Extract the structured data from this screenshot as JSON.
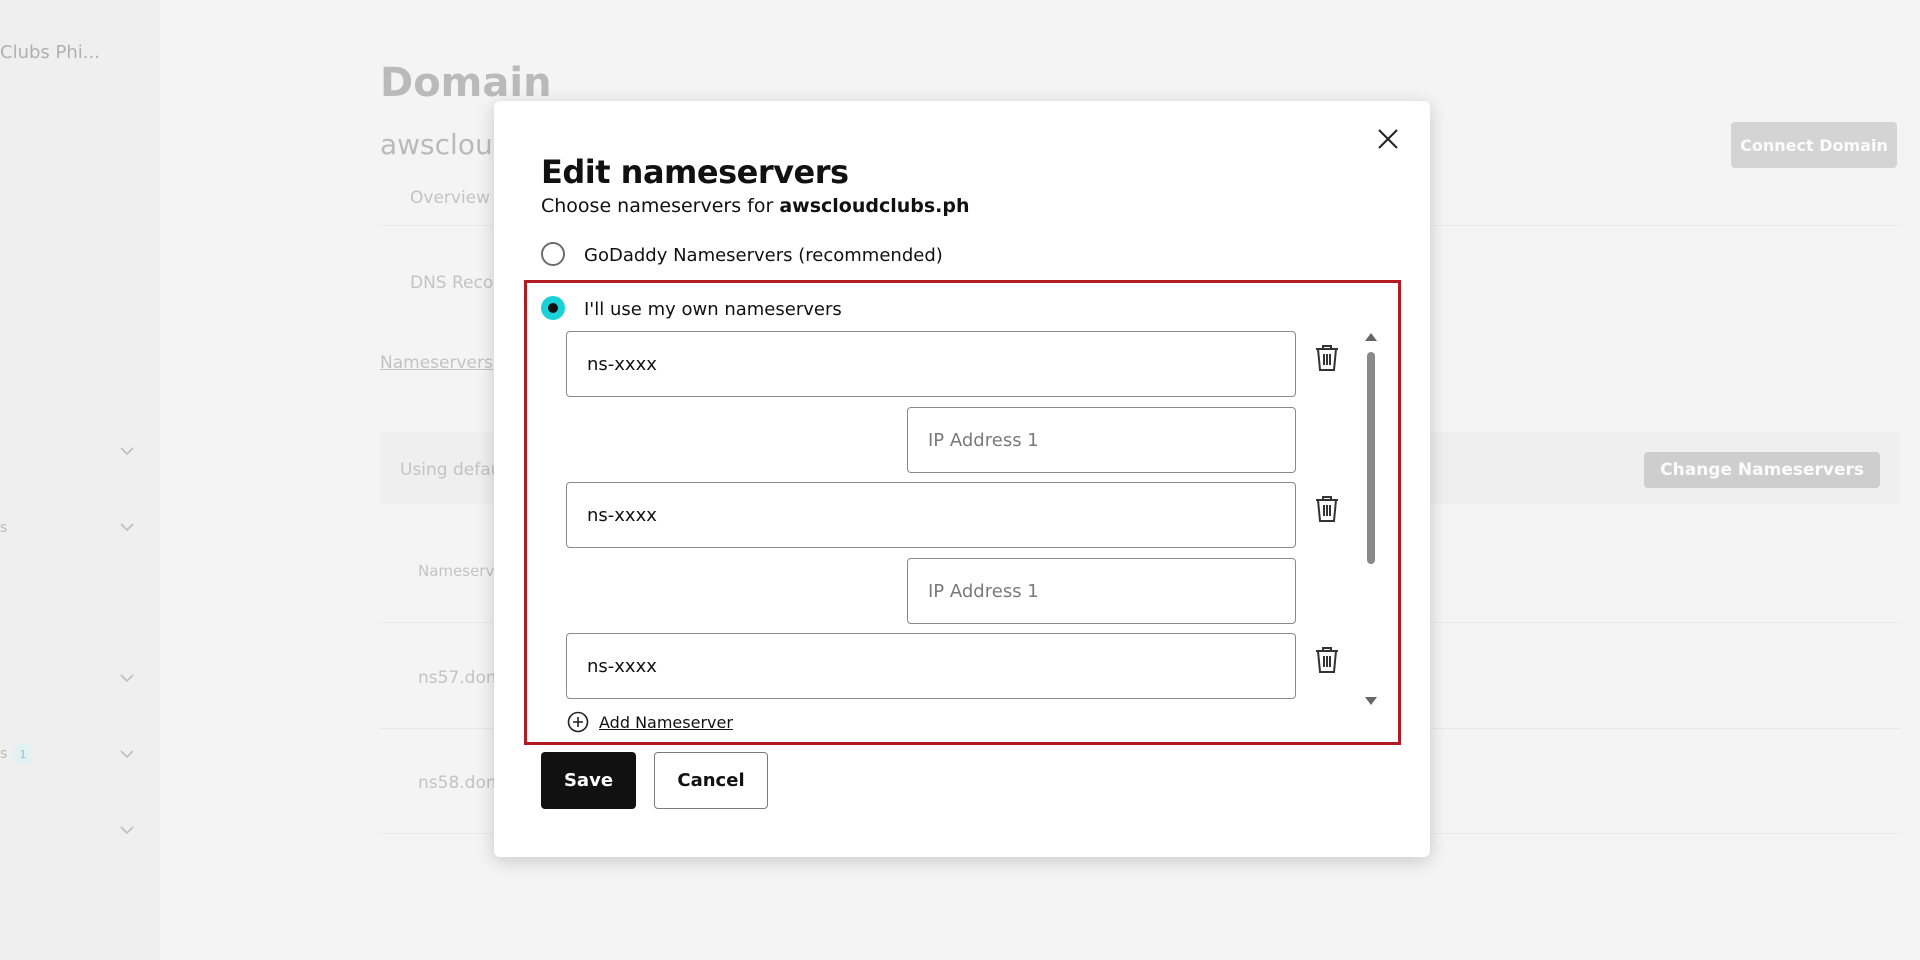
{
  "background": {
    "sidebar": {
      "brand": "Clubs Phi...",
      "frag1": "s",
      "frag2": "s",
      "badge": "1"
    },
    "page_title": "Domain",
    "domain_name": "awscloud",
    "tab_overview": "Overview",
    "dns_records": "DNS Reco",
    "nameservers_link": "Nameservers",
    "card_text": "Using defau",
    "change_ns_button": "Change Nameservers",
    "connect_domain_button": "Connect Domain",
    "table_header": "Nameserv",
    "rows": [
      "ns57.dom",
      "ns58.dom"
    ]
  },
  "modal": {
    "title": "Edit nameservers",
    "subtitle_prefix": "Choose nameservers for ",
    "subtitle_domain": "awscloudclubs.ph",
    "option_godaddy": "GoDaddy Nameservers (recommended)",
    "option_own": "I'll use my own nameservers",
    "selected_option": "own",
    "nameservers": [
      {
        "value": "ns-xxxx",
        "ip_placeholder": "IP Address 1"
      },
      {
        "value": "ns-xxxx",
        "ip_placeholder": "IP Address 1"
      },
      {
        "value": "ns-xxxx"
      }
    ],
    "add_nameserver": "Add Nameserver",
    "save": "Save",
    "cancel": "Cancel"
  },
  "colors": {
    "accent_radio": "#1bd1d8",
    "highlight_box": "#b31b22",
    "primary_button": "#111111"
  }
}
